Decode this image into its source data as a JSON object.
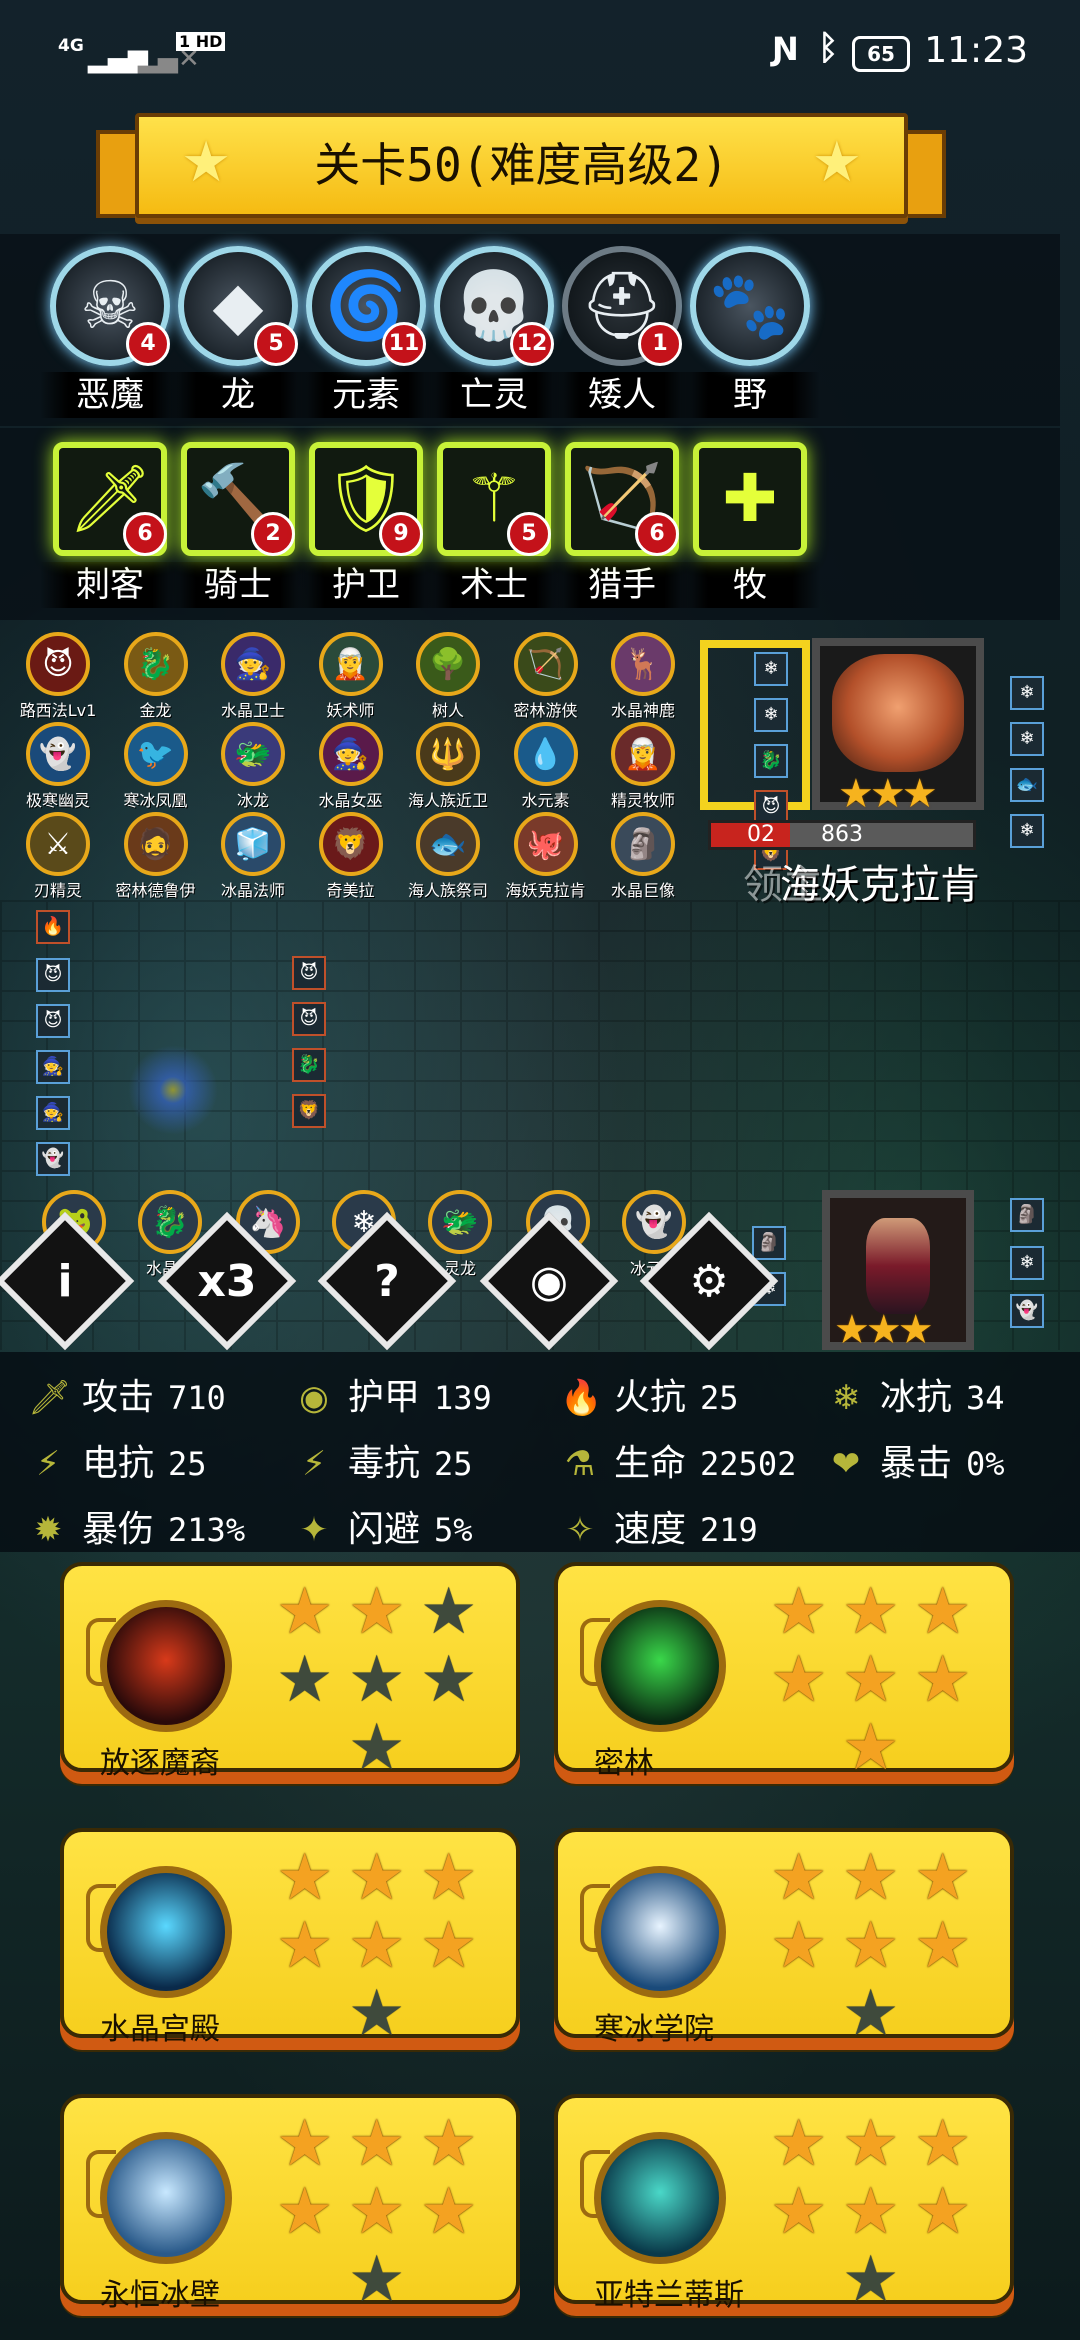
{
  "status_bar": {
    "network": "4G",
    "hd": "1 HD",
    "battery": "65",
    "time": "11:23"
  },
  "banner": {
    "title": "关卡50(难度高级2)"
  },
  "races": [
    {
      "name": "恶魔",
      "count": "4",
      "icon": "demon-skull-icon",
      "glyph": "☠",
      "active": true
    },
    {
      "name": "龙",
      "count": "5",
      "icon": "dragon-diamond-icon",
      "glyph": "◆",
      "active": true
    },
    {
      "name": "元素",
      "count": "11",
      "icon": "elemental-tornado-icon",
      "glyph": "🌀",
      "active": true
    },
    {
      "name": "亡灵",
      "count": "12",
      "icon": "undead-skull-icon",
      "glyph": "💀",
      "active": true
    },
    {
      "name": "矮人",
      "count": "1",
      "icon": "dwarf-helmet-icon",
      "glyph": "⛑",
      "active": false
    },
    {
      "name": "野",
      "count": "",
      "icon": "beast-paw-icon",
      "glyph": "🐾",
      "active": true
    }
  ],
  "classes": [
    {
      "name": "刺客",
      "count": "6",
      "icon": "assassin-dagger-icon",
      "glyph": "🗡"
    },
    {
      "name": "骑士",
      "count": "2",
      "icon": "knight-hammer-icon",
      "glyph": "🔨"
    },
    {
      "name": "护卫",
      "count": "9",
      "icon": "guard-shield-icon",
      "glyph": "🛡"
    },
    {
      "name": "术士",
      "count": "5",
      "icon": "warlock-staff-icon",
      "glyph": "⚚"
    },
    {
      "name": "猎手",
      "count": "6",
      "icon": "hunter-bow-icon",
      "glyph": "🏹"
    },
    {
      "name": "牧",
      "count": "",
      "icon": "priest-icon",
      "glyph": "✚"
    }
  ],
  "units": [
    {
      "name": "路西法Lv1",
      "glyph": "😈",
      "bg": "#6a1a14"
    },
    {
      "name": "金龙",
      "glyph": "🐉",
      "bg": "#7a5a14"
    },
    {
      "name": "水晶卫士",
      "glyph": "🧙",
      "bg": "#3a2a6a"
    },
    {
      "name": "妖术师",
      "glyph": "🧝",
      "bg": "#2a4a3a"
    },
    {
      "name": "树人",
      "glyph": "🌳",
      "bg": "#3a5a1a"
    },
    {
      "name": "密林游侠",
      "glyph": "🏹",
      "bg": "#3a4a1a"
    },
    {
      "name": "水晶神鹿",
      "glyph": "🦌",
      "bg": "#6a3a6a"
    },
    {
      "name": "极寒幽灵",
      "glyph": "👻",
      "bg": "#1a4a7a"
    },
    {
      "name": "寒冰凤凰",
      "glyph": "🐦",
      "bg": "#1a5a8a"
    },
    {
      "name": "冰龙",
      "glyph": "🐲",
      "bg": "#3a3a7a"
    },
    {
      "name": "水晶女巫",
      "glyph": "🧙",
      "bg": "#5a1a4a"
    },
    {
      "name": "海人族近卫",
      "glyph": "🔱",
      "bg": "#4a3a1a"
    },
    {
      "name": "水元素",
      "glyph": "💧",
      "bg": "#1a5a8a"
    },
    {
      "name": "精灵牧师",
      "glyph": "🧝",
      "bg": "#6a2a2a"
    },
    {
      "name": "刃精灵",
      "glyph": "⚔",
      "bg": "#5a4a1a"
    },
    {
      "name": "密林德鲁伊",
      "glyph": "🧔",
      "bg": "#6a3a1a"
    },
    {
      "name": "冰晶法师",
      "glyph": "🧊",
      "bg": "#2a4a6a"
    },
    {
      "name": "奇美拉",
      "glyph": "🦁",
      "bg": "#6a1a1a"
    },
    {
      "name": "海人族祭司",
      "glyph": "🐟",
      "bg": "#4a3a2a"
    },
    {
      "name": "海妖克拉肯",
      "glyph": "🐙",
      "bg": "#7a3a2a"
    },
    {
      "name": "水晶巨像",
      "glyph": "🗿",
      "bg": "#3a4a5a"
    }
  ],
  "boss": {
    "name": "海妖克拉肯",
    "ghost_text": "领主",
    "hp": "863",
    "hp_left": "02",
    "stars": "★★★"
  },
  "bench_units": [
    {
      "name": "",
      "glyph": "🐸"
    },
    {
      "name": "水晶龙",
      "glyph": "🐉"
    },
    {
      "name": "",
      "glyph": "🦄"
    },
    {
      "name": "",
      "glyph": "❄"
    },
    {
      "name": "灵龙",
      "glyph": "🐲"
    },
    {
      "name": "",
      "glyph": "💀"
    },
    {
      "name": "冰元素",
      "glyph": "👻"
    }
  ],
  "buttons": [
    {
      "name": "info",
      "label": "i"
    },
    {
      "name": "speed",
      "label": "x3"
    },
    {
      "name": "help",
      "label": "?"
    },
    {
      "name": "view",
      "label": "◉"
    },
    {
      "name": "settings",
      "label": "⚙"
    }
  ],
  "player": {
    "stars": "★★★"
  },
  "stats": [
    {
      "label": "攻击",
      "value": "710",
      "icon": "attack-sword-icon",
      "glyph": "🗡"
    },
    {
      "label": "护甲",
      "value": "139",
      "icon": "armor-shield-icon",
      "glyph": "◉"
    },
    {
      "label": "火抗",
      "value": "25",
      "icon": "fire-resist-icon",
      "glyph": "🔥"
    },
    {
      "label": "冰抗",
      "value": "34",
      "icon": "ice-resist-icon",
      "glyph": "❄"
    },
    {
      "label": "电抗",
      "value": "25",
      "icon": "lightning-resist-icon",
      "glyph": "⚡"
    },
    {
      "label": "毒抗",
      "value": "25",
      "icon": "poison-resist-icon",
      "glyph": "⚡"
    },
    {
      "label": "生命",
      "value": "22502",
      "icon": "life-flask-icon",
      "glyph": "⚗"
    },
    {
      "label": "暴击",
      "value": "0%",
      "icon": "crit-heart-icon",
      "glyph": "❤"
    },
    {
      "label": "暴伤",
      "value": "213%",
      "icon": "crit-damage-icon",
      "glyph": "✹"
    },
    {
      "label": "闪避",
      "value": "5%",
      "icon": "dodge-icon",
      "glyph": "✦"
    },
    {
      "label": "速度",
      "value": "219",
      "icon": "speed-icon",
      "glyph": "✧"
    }
  ],
  "regions": [
    {
      "name": "放逐魔裔",
      "stars_earned": 2,
      "colors": [
        "#d83a1a",
        "#2a0a0a"
      ]
    },
    {
      "name": "密林",
      "stars_earned": 7,
      "colors": [
        "#3ad84a",
        "#0a2a12"
      ]
    },
    {
      "name": "水晶宫殿",
      "stars_earned": 6,
      "colors": [
        "#5ad8ff",
        "#0a2a4a"
      ]
    },
    {
      "name": "寒冰学院",
      "stars_earned": 6,
      "colors": [
        "#e8f4ff",
        "#1a4a7a"
      ]
    },
    {
      "name": "永恒冰壁",
      "stars_earned": 6,
      "colors": [
        "#c8e8ff",
        "#2a5a8a"
      ]
    },
    {
      "name": "亚特兰蒂斯",
      "stars_earned": 6,
      "colors": [
        "#4ad8c8",
        "#0a3a4a"
      ]
    }
  ]
}
